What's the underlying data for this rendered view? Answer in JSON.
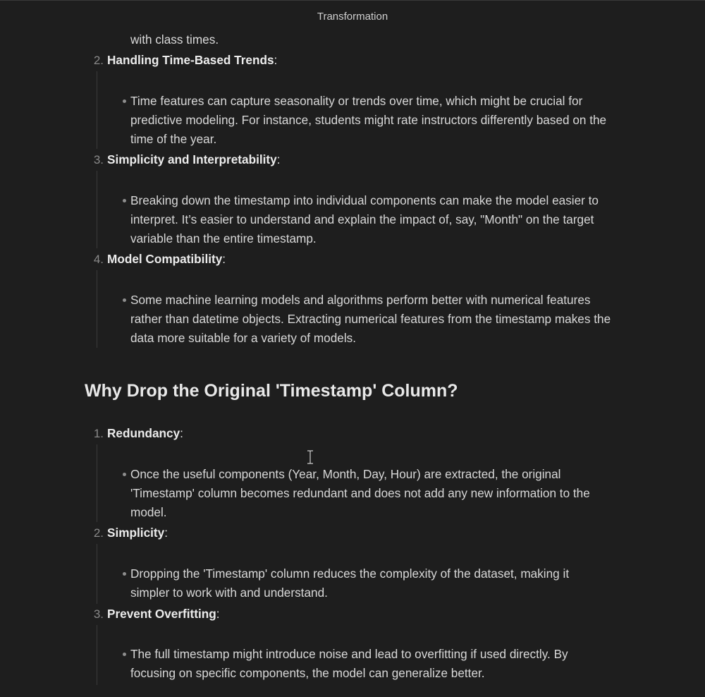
{
  "window": {
    "title": "Transformation"
  },
  "top_fragment": "with class times.",
  "section1": {
    "items": [
      {
        "number": "2.",
        "title": "Handling Time-Based Trends",
        "suffix": ":",
        "bullet_lines": [
          "Time features can capture seasonality or trends over time, which might be crucial for",
          "predictive modeling. For instance, students might rate instructors differently based on the",
          "time of the year."
        ]
      },
      {
        "number": "3.",
        "title": "Simplicity and Interpretability",
        "suffix": ":",
        "bullet_lines": [
          "Breaking down the timestamp into individual components can make the model easier to",
          "interpret. It’s easier to understand and explain the impact of, say, \"Month\" on the target",
          "variable than the entire timestamp."
        ]
      },
      {
        "number": "4.",
        "title": "Model Compatibility",
        "suffix": ":",
        "bullet_lines": [
          "Some machine learning models and algorithms perform better with numerical features",
          "rather than datetime objects. Extracting numerical features from the timestamp makes the",
          "data more suitable for a variety of models."
        ]
      }
    ]
  },
  "section2": {
    "heading": "Why Drop the Original 'Timestamp' Column?",
    "items": [
      {
        "number": "1.",
        "title": "Redundancy",
        "suffix": ":",
        "bullet_lines": [
          "Once the useful components (Year, Month, Day, Hour) are extracted, the original",
          "'Timestamp' column becomes redundant and does not add any new information to the",
          "model."
        ]
      },
      {
        "number": "2.",
        "title": "Simplicity",
        "suffix": ":",
        "bullet_lines": [
          "Dropping the 'Timestamp' column reduces the complexity of the dataset, making it",
          "simpler to work with and understand."
        ]
      },
      {
        "number": "3.",
        "title": "Prevent Overfitting",
        "suffix": ":",
        "bullet_lines": [
          "The full timestamp might introduce noise and lead to overfitting if used directly. By",
          "focusing on specific components, the model can generalize better."
        ]
      }
    ]
  },
  "cursor": {
    "icon": "text-cursor-icon"
  }
}
